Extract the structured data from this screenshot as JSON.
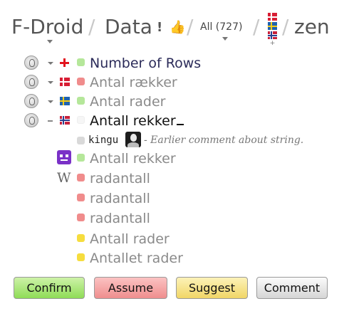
{
  "header": {
    "project": "F-Droid",
    "resource": "Data",
    "filter": "All (727)",
    "user": "zen"
  },
  "rows": [
    {
      "text": "Number of Rows",
      "dot_color": "#b5e79a",
      "flag": "plus"
    },
    {
      "text": "Antal rækker",
      "dot_color": "#f08c8c",
      "flag": "danish"
    },
    {
      "text": "Antal rader",
      "dot_color": "#b5e79a",
      "flag": "swedish"
    },
    {
      "text": "Antall rekker",
      "dot_color": "#f2f2f2",
      "flag": "norwegian"
    }
  ],
  "comment": {
    "user": "kingu",
    "text": "- Earlier comment about string."
  },
  "suggestions": [
    {
      "text": "Antall rekker",
      "dot_color": "#b5e79a",
      "source": "robot-icon"
    },
    {
      "text": "radantall",
      "dot_color": "#f08c8c",
      "source": "wikipedia-icon"
    },
    {
      "text": "radantall",
      "dot_color": "#f08c8c",
      "source": ""
    },
    {
      "text": "radantall",
      "dot_color": "#f08c8c",
      "source": ""
    },
    {
      "text": "Antall rader",
      "dot_color": "#f6dd3e",
      "source": ""
    },
    {
      "text": "Antallet rader",
      "dot_color": "#f6dd3e",
      "source": ""
    }
  ],
  "buttons": {
    "confirm": "Confirm",
    "assume": "Assume",
    "suggest": "Suggest",
    "comment": "Comment"
  }
}
